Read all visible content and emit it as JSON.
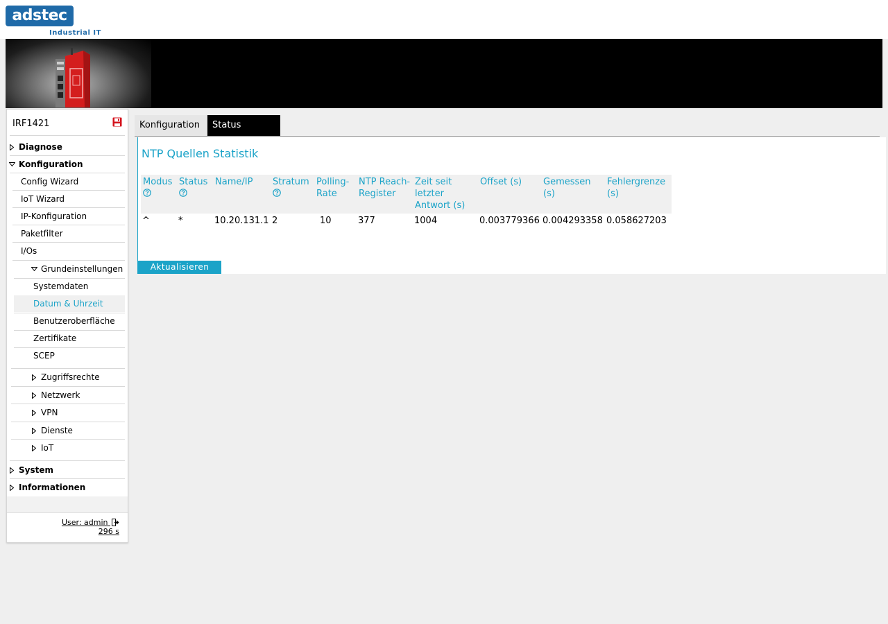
{
  "brand": {
    "logo_text": "adstec",
    "tagline": "Industrial IT"
  },
  "device": {
    "name": "IRF1421"
  },
  "sidebar": {
    "top": [
      {
        "label": "Diagnose",
        "state": "collapsed"
      },
      {
        "label": "Konfiguration",
        "state": "expanded"
      }
    ],
    "konfiguration_items": [
      "Config Wizard",
      "IoT Wizard",
      "IP-Konfiguration",
      "Paketfilter",
      "I/Os"
    ],
    "grundeinstellungen": {
      "label": "Grundeinstellungen",
      "items": [
        "Systemdaten",
        "Datum & Uhrzeit",
        "Benutzeroberfläche",
        "Zertifikate",
        "SCEP"
      ],
      "active_item": "Datum & Uhrzeit"
    },
    "sub_groups": [
      "Zugriffsrechte",
      "Netzwerk",
      "VPN",
      "Dienste",
      "IoT"
    ],
    "bottom": [
      "System",
      "Informationen"
    ],
    "footer": {
      "user": "User: admin",
      "timer": "296 s"
    }
  },
  "tabs": [
    {
      "label": "Konfiguration",
      "active": false
    },
    {
      "label": "Status",
      "active": true
    }
  ],
  "panel": {
    "title": "NTP Quellen Statistik",
    "columns": [
      "Modus",
      "Status",
      "Name/IP",
      "Stratum",
      "Polling-Rate",
      "NTP Reach-Register",
      "Zeit seit letzter Antwort (s)",
      "Offset (s)",
      "Gemessen (s)",
      "Fehlergrenze (s)"
    ],
    "rows": [
      [
        "^",
        "*",
        "10.20.131.1",
        "2",
        "10",
        "377",
        "1004",
        "0.003779366",
        "0.004293358",
        "0.058627203"
      ]
    ],
    "refresh_label": "Aktualisieren"
  },
  "colors": {
    "accent": "#1ba3c8",
    "brand": "#1f6aa8",
    "save_icon": "#d4121c"
  }
}
